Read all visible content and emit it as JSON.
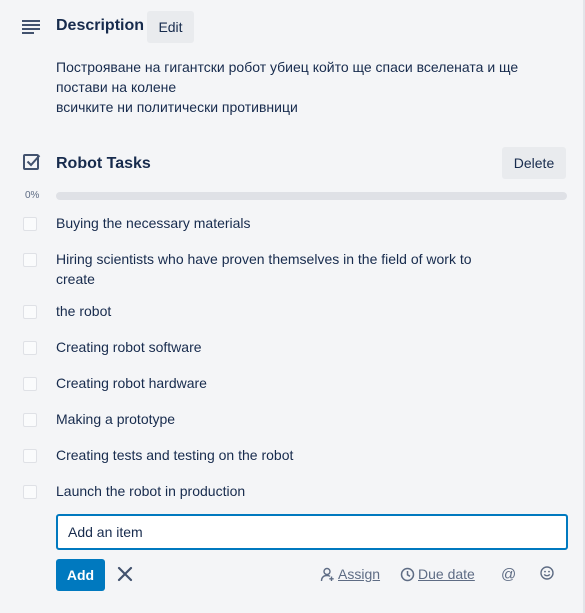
{
  "description": {
    "title": "Description",
    "edit_label": "Edit",
    "lines": [
      "Построяване на гигантски робот убиец който ще спаси вселената и ще",
      "постави на колене",
      "всичките ни политически противници"
    ]
  },
  "checklist": {
    "title": "Robot Tasks",
    "delete_label": "Delete",
    "progress_label": "0%",
    "progress_fraction": 0,
    "items": [
      {
        "label": "Buying the necessary materials"
      },
      {
        "label": "Hiring scientists who have proven themselves in the field of work to\ncreate"
      },
      {
        "label": "the robot"
      },
      {
        "label": "Creating robot software"
      },
      {
        "label": "Creating robot hardware"
      },
      {
        "label": "Making a prototype"
      },
      {
        "label": "Creating tests and testing on the robot"
      },
      {
        "label": "Launch the robot in production"
      }
    ]
  },
  "add_item": {
    "placeholder": "Add an item",
    "add_label": "Add",
    "assign_label": "Assign",
    "due_date_label": "Due date",
    "mention_symbol": "@"
  },
  "icons": {
    "description": "description-lines-icon",
    "checklist": "checkbox-check-icon",
    "close": "close-icon",
    "assign": "person-add-icon",
    "due": "clock-icon",
    "mention": "at-icon",
    "emoji": "smiley-icon"
  },
  "colors": {
    "accent": "#0079bf",
    "text": "#172b4d",
    "muted": "#5e6c84",
    "background": "#f4f5f7"
  }
}
